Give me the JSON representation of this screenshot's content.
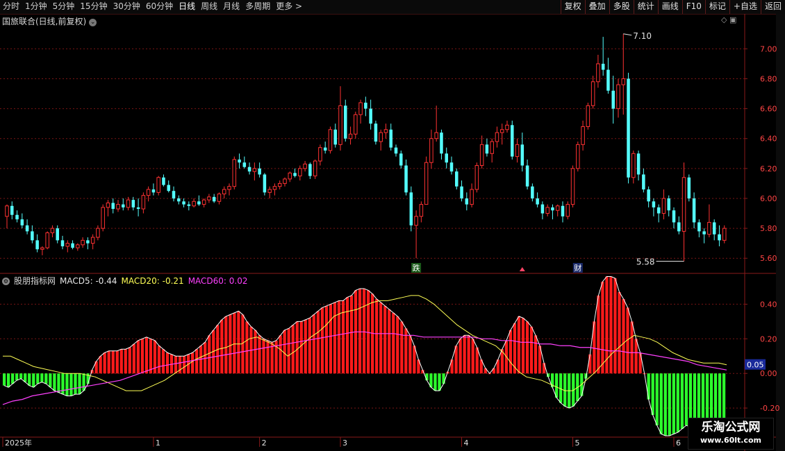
{
  "toolbar": {
    "periods": [
      "分时",
      "1分钟",
      "5分钟",
      "15分钟",
      "30分钟",
      "60分钟",
      "日线",
      "周线",
      "月线",
      "多周期",
      "更多 >"
    ],
    "active": "日线",
    "buttons": [
      "复权",
      "叠加",
      "多股",
      "统计",
      "画线",
      "F10",
      "标记",
      "+自选",
      "返回"
    ]
  },
  "stock_title": "国旅联合(日线,前复权)",
  "indicator": {
    "name": "股朋指标网",
    "macd5_label": "MACD5: -0.44",
    "macd20_label": "MACD20: -0.21",
    "macd60_label": "MACD60: 0.02"
  },
  "logo": {
    "line1": "乐淘公式网",
    "line2": "www.60lt.com"
  },
  "colors": {
    "up": "#ff3232",
    "down": "#54ffff",
    "macd_pos": "#ff1a1a",
    "macd_neg": "#2cff2c",
    "line20": "#ffff55",
    "line60": "#ff40ff",
    "grid": "#7a1515",
    "axis_text": "#ff4444"
  },
  "chart_data": [
    {
      "type": "candlestick",
      "y_ticks": [
        "7.00",
        "6.80",
        "6.60",
        "6.40",
        "6.20",
        "6.00",
        "5.80",
        "5.60"
      ],
      "ylim": [
        5.55,
        7.15
      ],
      "annotations": {
        "high": "7.10",
        "low": "5.58",
        "markers": [
          "跌",
          "财"
        ]
      },
      "x_labels": [
        "2025年",
        "1",
        "2",
        "3",
        "4",
        "5",
        "6"
      ],
      "ohlc": [
        [
          5.88,
          5.96,
          5.8,
          5.95
        ],
        [
          5.95,
          5.98,
          5.86,
          5.89
        ],
        [
          5.89,
          5.92,
          5.84,
          5.86
        ],
        [
          5.86,
          5.9,
          5.8,
          5.82
        ],
        [
          5.82,
          5.86,
          5.76,
          5.78
        ],
        [
          5.78,
          5.82,
          5.7,
          5.72
        ],
        [
          5.72,
          5.76,
          5.64,
          5.66
        ],
        [
          5.66,
          5.68,
          5.62,
          5.67
        ],
        [
          5.67,
          5.78,
          5.66,
          5.77
        ],
        [
          5.77,
          5.82,
          5.74,
          5.8
        ],
        [
          5.8,
          5.82,
          5.7,
          5.72
        ],
        [
          5.72,
          5.75,
          5.66,
          5.68
        ],
        [
          5.68,
          5.72,
          5.64,
          5.7
        ],
        [
          5.7,
          5.72,
          5.66,
          5.67
        ],
        [
          5.67,
          5.7,
          5.65,
          5.69
        ],
        [
          5.69,
          5.74,
          5.67,
          5.72
        ],
        [
          5.72,
          5.74,
          5.66,
          5.7
        ],
        [
          5.7,
          5.76,
          5.66,
          5.74
        ],
        [
          5.74,
          5.82,
          5.72,
          5.8
        ],
        [
          5.8,
          5.96,
          5.78,
          5.94
        ],
        [
          5.94,
          5.99,
          5.88,
          5.97
        ],
        [
          5.97,
          6.0,
          5.9,
          5.93
        ],
        [
          5.93,
          5.99,
          5.91,
          5.96
        ],
        [
          5.96,
          6.0,
          5.92,
          5.94
        ],
        [
          5.94,
          6.01,
          5.92,
          5.99
        ],
        [
          5.99,
          6.01,
          5.92,
          5.94
        ],
        [
          5.94,
          6.0,
          5.88,
          5.93
        ],
        [
          5.93,
          6.04,
          5.9,
          6.02
        ],
        [
          6.02,
          6.08,
          5.98,
          6.06
        ],
        [
          6.06,
          6.1,
          6.02,
          6.04
        ],
        [
          6.04,
          6.15,
          6.02,
          6.14
        ],
        [
          6.14,
          6.16,
          6.08,
          6.09
        ],
        [
          6.09,
          6.12,
          6.04,
          6.05
        ],
        [
          6.05,
          6.08,
          5.98,
          6.0
        ],
        [
          6.0,
          6.02,
          5.96,
          5.98
        ],
        [
          5.98,
          6.0,
          5.94,
          5.96
        ],
        [
          5.96,
          5.98,
          5.92,
          5.95
        ],
        [
          5.95,
          6.0,
          5.94,
          5.98
        ],
        [
          5.98,
          6.02,
          5.95,
          5.96
        ],
        [
          5.96,
          6.0,
          5.94,
          5.99
        ],
        [
          5.99,
          6.03,
          5.97,
          6.01
        ],
        [
          6.01,
          6.03,
          5.97,
          5.98
        ],
        [
          5.98,
          6.04,
          5.96,
          6.03
        ],
        [
          6.03,
          6.08,
          6.0,
          6.06
        ],
        [
          6.06,
          6.1,
          6.02,
          6.08
        ],
        [
          6.08,
          6.28,
          6.06,
          6.26
        ],
        [
          6.26,
          6.3,
          6.2,
          6.24
        ],
        [
          6.24,
          6.28,
          6.2,
          6.21
        ],
        [
          6.21,
          6.24,
          6.16,
          6.18
        ],
        [
          6.18,
          6.24,
          6.12,
          6.2
        ],
        [
          6.2,
          6.24,
          6.14,
          6.16
        ],
        [
          6.16,
          6.17,
          6.02,
          6.04
        ],
        [
          6.04,
          6.08,
          6.0,
          6.06
        ],
        [
          6.06,
          6.1,
          6.02,
          6.08
        ],
        [
          6.08,
          6.12,
          6.06,
          6.1
        ],
        [
          6.1,
          6.14,
          6.08,
          6.13
        ],
        [
          6.13,
          6.18,
          6.11,
          6.17
        ],
        [
          6.17,
          6.2,
          6.14,
          6.15
        ],
        [
          6.15,
          6.22,
          6.12,
          6.2
        ],
        [
          6.2,
          6.25,
          6.18,
          6.23
        ],
        [
          6.23,
          6.24,
          6.13,
          6.15
        ],
        [
          6.15,
          6.26,
          6.13,
          6.25
        ],
        [
          6.25,
          6.36,
          6.22,
          6.34
        ],
        [
          6.34,
          6.38,
          6.3,
          6.32
        ],
        [
          6.32,
          6.48,
          6.3,
          6.46
        ],
        [
          6.46,
          6.5,
          6.34,
          6.36
        ],
        [
          6.36,
          6.75,
          6.32,
          6.62
        ],
        [
          6.62,
          6.66,
          6.38,
          6.4
        ],
        [
          6.4,
          6.48,
          6.36,
          6.43
        ],
        [
          6.43,
          6.58,
          6.4,
          6.56
        ],
        [
          6.56,
          6.66,
          6.5,
          6.64
        ],
        [
          6.64,
          6.68,
          6.55,
          6.6
        ],
        [
          6.6,
          6.66,
          6.46,
          6.5
        ],
        [
          6.5,
          6.52,
          6.36,
          6.38
        ],
        [
          6.38,
          6.46,
          6.32,
          6.44
        ],
        [
          6.44,
          6.5,
          6.4,
          6.46
        ],
        [
          6.46,
          6.5,
          6.32,
          6.34
        ],
        [
          6.34,
          6.36,
          6.28,
          6.3
        ],
        [
          6.3,
          6.32,
          6.2,
          6.22
        ],
        [
          6.22,
          6.26,
          6.02,
          6.04
        ],
        [
          6.04,
          6.08,
          5.78,
          5.82
        ],
        [
          5.82,
          5.92,
          5.6,
          5.88
        ],
        [
          5.88,
          5.98,
          5.84,
          5.96
        ],
        [
          5.96,
          6.28,
          5.98,
          6.24
        ],
        [
          6.24,
          6.46,
          6.2,
          6.4
        ],
        [
          6.4,
          6.62,
          6.38,
          6.44
        ],
        [
          6.44,
          6.46,
          6.26,
          6.3
        ],
        [
          6.3,
          6.34,
          6.2,
          6.24
        ],
        [
          6.24,
          6.28,
          6.16,
          6.18
        ],
        [
          6.18,
          6.2,
          6.06,
          6.08
        ],
        [
          6.08,
          6.12,
          5.98,
          6.0
        ],
        [
          6.0,
          6.04,
          5.92,
          5.96
        ],
        [
          5.96,
          6.1,
          5.94,
          6.06
        ],
        [
          6.06,
          6.24,
          6.04,
          6.22
        ],
        [
          6.22,
          6.42,
          6.2,
          6.36
        ],
        [
          6.36,
          6.4,
          6.28,
          6.3
        ],
        [
          6.3,
          6.4,
          6.24,
          6.38
        ],
        [
          6.38,
          6.48,
          6.34,
          6.44
        ],
        [
          6.44,
          6.5,
          6.36,
          6.46
        ],
        [
          6.46,
          6.52,
          6.44,
          6.49
        ],
        [
          6.49,
          6.52,
          6.26,
          6.28
        ],
        [
          6.28,
          6.4,
          6.24,
          6.36
        ],
        [
          6.36,
          6.44,
          6.18,
          6.22
        ],
        [
          6.22,
          6.26,
          6.06,
          6.08
        ],
        [
          6.08,
          6.1,
          5.98,
          6.0
        ],
        [
          6.0,
          6.04,
          5.94,
          5.96
        ],
        [
          5.96,
          5.98,
          5.86,
          5.9
        ],
        [
          5.9,
          5.96,
          5.88,
          5.94
        ],
        [
          5.94,
          5.96,
          5.86,
          5.92
        ],
        [
          5.92,
          5.96,
          5.88,
          5.95
        ],
        [
          5.95,
          5.98,
          5.84,
          5.88
        ],
        [
          5.88,
          5.98,
          5.86,
          5.96
        ],
        [
          5.96,
          6.22,
          5.94,
          6.2
        ],
        [
          6.2,
          6.38,
          6.18,
          6.36
        ],
        [
          6.36,
          6.52,
          6.32,
          6.48
        ],
        [
          6.48,
          6.64,
          6.46,
          6.62
        ],
        [
          6.62,
          6.82,
          6.6,
          6.78
        ],
        [
          6.78,
          6.96,
          6.74,
          6.9
        ],
        [
          6.9,
          7.08,
          6.82,
          6.86
        ],
        [
          6.86,
          6.94,
          6.7,
          6.72
        ],
        [
          6.72,
          6.82,
          6.5,
          6.6
        ],
        [
          6.6,
          6.8,
          6.54,
          6.76
        ],
        [
          6.76,
          7.1,
          6.56,
          6.8
        ],
        [
          6.8,
          6.84,
          6.1,
          6.14
        ],
        [
          6.14,
          6.32,
          6.1,
          6.3
        ],
        [
          6.3,
          6.32,
          6.12,
          6.16
        ],
        [
          6.16,
          6.2,
          6.04,
          6.06
        ],
        [
          6.06,
          6.08,
          5.94,
          5.98
        ],
        [
          5.98,
          6.0,
          5.88,
          5.94
        ],
        [
          5.94,
          5.96,
          5.84,
          5.9
        ],
        [
          5.9,
          6.06,
          5.86,
          6.0
        ],
        [
          6.0,
          6.02,
          5.88,
          5.92
        ],
        [
          5.92,
          5.94,
          5.8,
          5.84
        ],
        [
          5.84,
          5.88,
          5.76,
          5.78
        ],
        [
          5.78,
          6.24,
          5.58,
          6.14
        ],
        [
          6.14,
          6.16,
          5.98,
          6.0
        ],
        [
          6.0,
          6.04,
          5.8,
          5.84
        ],
        [
          5.84,
          5.86,
          5.74,
          5.78
        ],
        [
          5.78,
          5.8,
          5.7,
          5.76
        ],
        [
          5.76,
          5.96,
          5.74,
          5.84
        ],
        [
          5.84,
          5.86,
          5.72,
          5.76
        ],
        [
          5.76,
          5.82,
          5.68,
          5.72
        ],
        [
          5.72,
          5.82,
          5.7,
          5.8
        ]
      ]
    },
    {
      "type": "bar",
      "y_ticks": [
        "0.40",
        "0.20",
        "0.00",
        "-0.20"
      ],
      "ylim": [
        -0.36,
        0.57
      ],
      "current_value": "0.05",
      "series": [
        {
          "name": "MACD5",
          "values": [
            -0.07,
            -0.08,
            -0.06,
            -0.04,
            -0.03,
            -0.05,
            -0.07,
            -0.08,
            -0.06,
            -0.05,
            -0.06,
            -0.08,
            -0.1,
            -0.11,
            -0.12,
            -0.13,
            -0.13,
            -0.12,
            -0.12,
            -0.1,
            -0.06,
            0.02,
            0.07,
            0.1,
            0.12,
            0.13,
            0.13,
            0.13,
            0.14,
            0.14,
            0.15,
            0.17,
            0.19,
            0.2,
            0.21,
            0.2,
            0.19,
            0.16,
            0.14,
            0.12,
            0.11,
            0.1,
            0.1,
            0.1,
            0.11,
            0.12,
            0.14,
            0.16,
            0.18,
            0.22,
            0.25,
            0.28,
            0.31,
            0.33,
            0.34,
            0.35,
            0.36,
            0.34,
            0.3,
            0.27,
            0.25,
            0.22,
            0.2,
            0.19,
            0.18,
            0.19,
            0.22,
            0.25,
            0.26,
            0.28,
            0.3,
            0.3,
            0.31,
            0.32,
            0.34,
            0.36,
            0.38,
            0.39,
            0.4,
            0.41,
            0.42,
            0.42,
            0.44,
            0.45,
            0.48,
            0.49,
            0.49,
            0.48,
            0.46,
            0.43,
            0.41,
            0.39,
            0.37,
            0.35,
            0.33,
            0.3,
            0.26,
            0.22,
            0.16,
            0.08,
            0.02,
            -0.04,
            -0.08,
            -0.1,
            -0.1,
            -0.06,
            0.01,
            0.08,
            0.16,
            0.2,
            0.22,
            0.22,
            0.2,
            0.15,
            0.08,
            0.03,
            0.0,
            0.03,
            0.08,
            0.14,
            0.19,
            0.25,
            0.29,
            0.33,
            0.32,
            0.3,
            0.27,
            0.22,
            0.16,
            0.06,
            -0.02,
            -0.08,
            -0.14,
            -0.17,
            -0.19,
            -0.2,
            -0.19,
            -0.16,
            -0.13,
            -0.03,
            0.11,
            0.3,
            0.45,
            0.53,
            0.56,
            0.56,
            0.55,
            0.47,
            0.43,
            0.38,
            0.3,
            0.2,
            0.12,
            0.0,
            -0.15,
            -0.24,
            -0.3,
            -0.35,
            -0.36,
            -0.36,
            -0.35,
            -0.34,
            -0.32,
            -0.3,
            -0.31,
            -0.32,
            -0.31,
            -0.32,
            -0.32,
            -0.33,
            -0.32,
            -0.32,
            -0.32
          ]
        },
        {
          "name": "MACD20",
          "values": [
            0.1,
            0.1,
            0.08,
            0.06,
            0.04,
            0.03,
            0.02,
            0.01,
            0.0,
            0.0,
            0.0,
            -0.01,
            -0.02,
            -0.04,
            -0.06,
            -0.08,
            -0.1,
            -0.1,
            -0.1,
            -0.08,
            -0.06,
            -0.04,
            -0.01,
            0.02,
            0.05,
            0.08,
            0.1,
            0.12,
            0.14,
            0.15,
            0.17,
            0.17,
            0.2,
            0.21,
            0.19,
            0.17,
            0.14,
            0.1,
            0.13,
            0.17,
            0.21,
            0.24,
            0.28,
            0.33,
            0.35,
            0.36,
            0.37,
            0.39,
            0.41,
            0.42,
            0.42,
            0.43,
            0.44,
            0.45,
            0.45,
            0.43,
            0.4,
            0.36,
            0.32,
            0.28,
            0.25,
            0.22,
            0.2,
            0.18,
            0.16,
            0.12,
            0.06,
            0.01,
            -0.02,
            -0.03,
            -0.04,
            -0.06,
            -0.08,
            -0.1,
            -0.1,
            -0.07,
            -0.03,
            0.01,
            0.06,
            0.11,
            0.15,
            0.19,
            0.22,
            0.21,
            0.2,
            0.18,
            0.15,
            0.12,
            0.1,
            0.08,
            0.07,
            0.06,
            0.06,
            0.06,
            0.05
          ]
        },
        {
          "name": "MACD60",
          "values": [
            -0.18,
            -0.16,
            -0.15,
            -0.13,
            -0.12,
            -0.11,
            -0.1,
            -0.09,
            -0.08,
            -0.07,
            -0.06,
            -0.05,
            -0.04,
            -0.02,
            0.0,
            0.02,
            0.04,
            0.05,
            0.06,
            0.07,
            0.08,
            0.09,
            0.1,
            0.11,
            0.12,
            0.13,
            0.14,
            0.15,
            0.16,
            0.17,
            0.18,
            0.19,
            0.2,
            0.21,
            0.22,
            0.23,
            0.24,
            0.24,
            0.23,
            0.23,
            0.23,
            0.22,
            0.22,
            0.21,
            0.21,
            0.21,
            0.21,
            0.21,
            0.21,
            0.2,
            0.2,
            0.19,
            0.19,
            0.18,
            0.18,
            0.17,
            0.17,
            0.16,
            0.16,
            0.15,
            0.15,
            0.14,
            0.13,
            0.13,
            0.12,
            0.12,
            0.11,
            0.1,
            0.09,
            0.08,
            0.07,
            0.05,
            0.04,
            0.03,
            0.02
          ]
        }
      ]
    }
  ]
}
